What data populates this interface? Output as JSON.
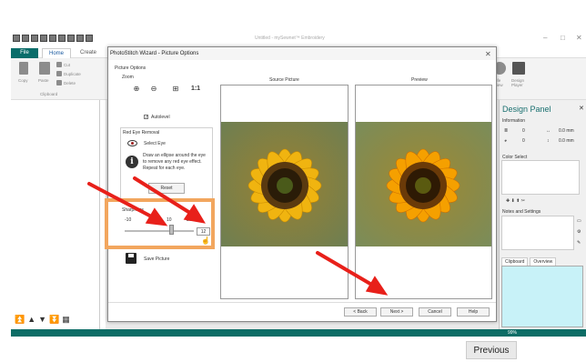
{
  "app": {
    "window_title": "Untitled - mySewnet™ Embroidery",
    "tabs": [
      "File",
      "Home",
      "Create"
    ],
    "ribbon": {
      "copy": "Copy",
      "paste": "Paste",
      "cut": "Cut",
      "duplicate": "Duplicate",
      "delete": "Delete",
      "clipboard": "Clipboard",
      "life_view": "Life View",
      "design_player": "Design Player"
    }
  },
  "dialog": {
    "title": "PhotoStitch Wizard - Picture Options",
    "section": "Picture Options",
    "zoom_label": "Zoom",
    "zoom_buttons": [
      "⊕",
      "⊖",
      "⊞",
      "1:1"
    ],
    "autolevel": "Autolevel",
    "red_eye_label": "Red Eye Removal",
    "select_eye": "Select Eye",
    "info_text": "Draw an ellipse around the eye to remove any red eye effect. Repeat for each eye.",
    "reset": "Reset",
    "sharpness_label": "Sharpness",
    "sharpness_ticks": [
      "-10",
      "10",
      "20"
    ],
    "sharpness_value": "12",
    "save_picture": "Save Picture",
    "source_label": "Source Picture",
    "preview_label": "Preview",
    "buttons": [
      "< Back",
      "Next >",
      "Cancel",
      "Help"
    ]
  },
  "design_panel": {
    "title": "Design Panel",
    "information": "Information",
    "info_vals": [
      "0",
      "0.0 mm",
      "0",
      "0.0 mm"
    ],
    "color_select": "Color Select",
    "notes": "Notes and Settings",
    "tabs": [
      "Clipboard",
      "Overview"
    ]
  },
  "status": {
    "zoom": "99%"
  },
  "tooltip": "Previous"
}
